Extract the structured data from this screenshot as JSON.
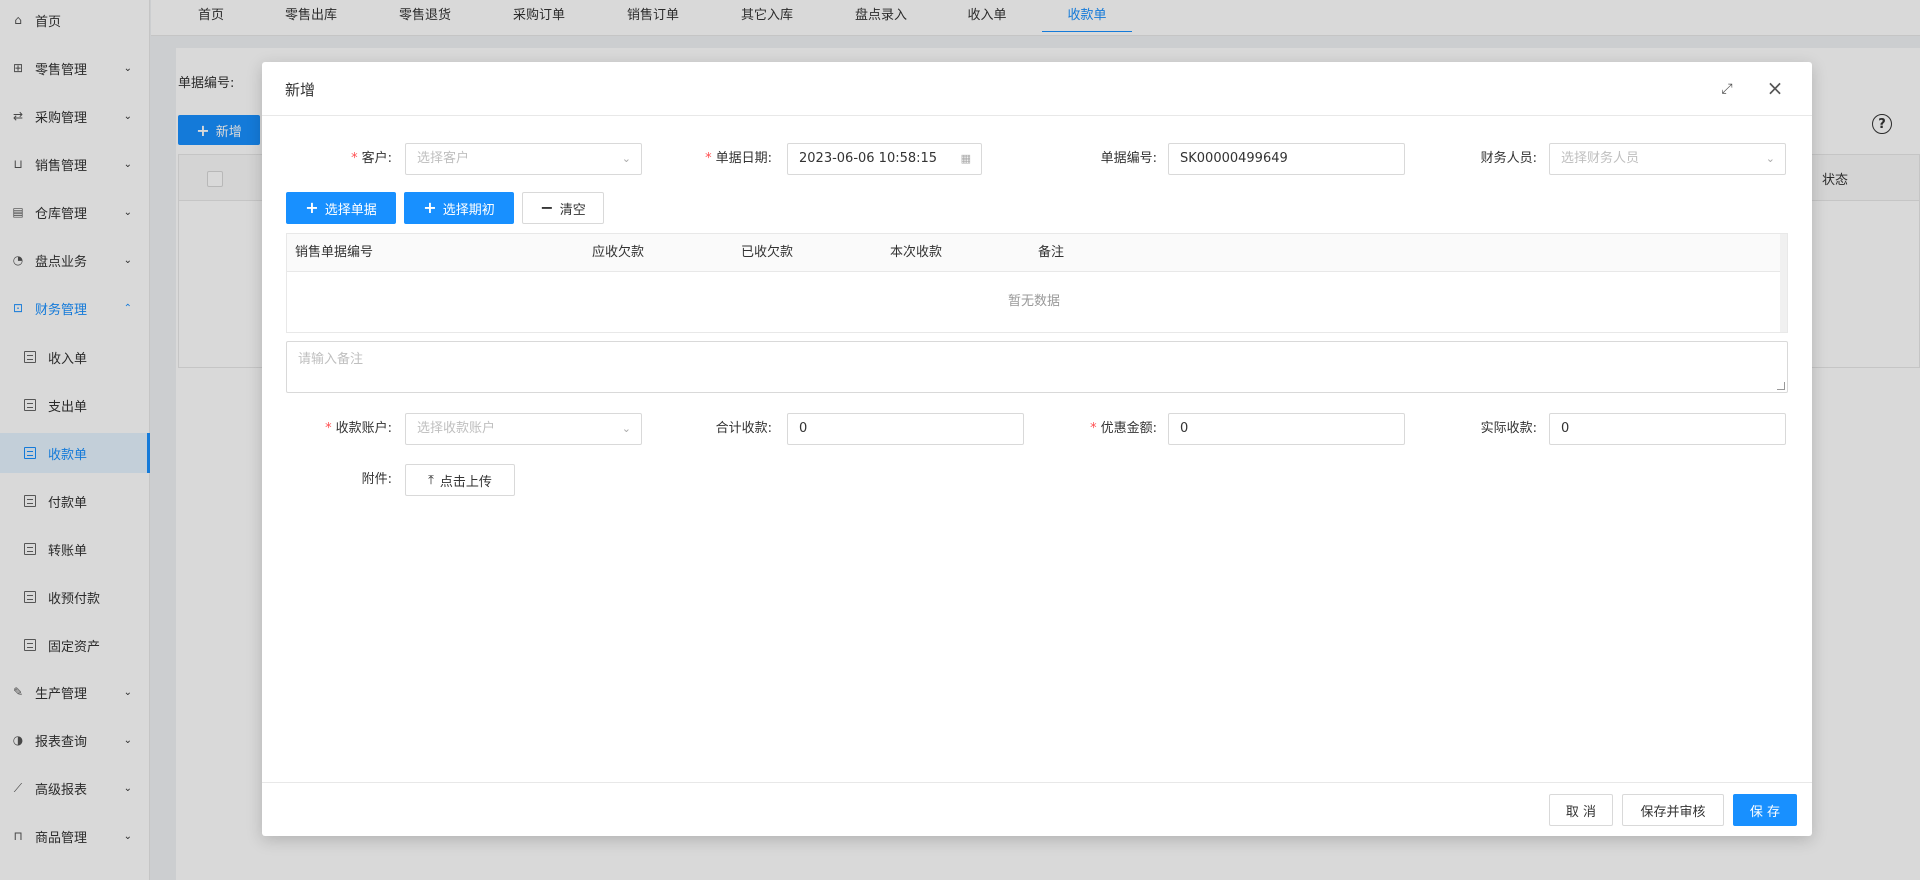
{
  "sidebar": {
    "menu": [
      {
        "label": "首页",
        "icon": "home-icon",
        "arrow": ""
      },
      {
        "label": "零售管理",
        "icon": "gift-icon",
        "arrow": "⌄"
      },
      {
        "label": "采购管理",
        "icon": "swap-icon",
        "arrow": "⌄"
      },
      {
        "label": "销售管理",
        "icon": "cart-icon",
        "arrow": "⌄"
      },
      {
        "label": "仓库管理",
        "icon": "warehouse-icon",
        "arrow": "⌄"
      },
      {
        "label": "盘点业务",
        "icon": "dashboard-icon",
        "arrow": "⌄"
      },
      {
        "label": "财务管理",
        "icon": "finance-icon",
        "arrow": "⌃"
      },
      {
        "label": "生产管理",
        "icon": "wrench-icon",
        "arrow": "⌄"
      },
      {
        "label": "报表查询",
        "icon": "pie-icon",
        "arrow": "⌄"
      },
      {
        "label": "高级报表",
        "icon": "line-chart-icon",
        "arrow": "⌄"
      },
      {
        "label": "商品管理",
        "icon": "bag-icon",
        "arrow": "⌄"
      }
    ],
    "finance_sub": [
      "收入单",
      "支出单",
      "收款单",
      "付款单",
      "转账单",
      "收预付款",
      "固定资产"
    ]
  },
  "tabs": [
    "首页",
    "零售出库",
    "零售退货",
    "采购订单",
    "销售订单",
    "其它入库",
    "盘点录入",
    "收入单",
    "收款单"
  ],
  "background": {
    "doc_no_label": "单据编号:",
    "add_button": "新增",
    "status_header": "状态"
  },
  "modal": {
    "title": "新增",
    "customer_label": "客户:",
    "customer_placeholder": "选择客户",
    "date_label": "单据日期:",
    "date_value": "2023-06-06 10:58:15",
    "doc_no_label": "单据编号:",
    "doc_no_value": "SK00000499649",
    "finance_staff_label": "财务人员:",
    "finance_staff_placeholder": "选择财务人员",
    "select_doc_button": "选择单据",
    "select_initial_button": "选择期初",
    "clear_button": "清空",
    "table_headers": [
      "销售单据编号",
      "应收欠款",
      "已收欠款",
      "本次收款",
      "备注"
    ],
    "table_empty": "暂无数据",
    "remark_placeholder": "请输入备注",
    "account_label": "收款账户:",
    "account_placeholder": "选择收款账户",
    "total_label": "合计收款:",
    "total_value": "0",
    "discount_label": "优惠金额:",
    "discount_value": "0",
    "actual_label": "实际收款:",
    "actual_value": "0",
    "attachment_label": "附件:",
    "upload_button": "点击上传",
    "cancel_button": "取 消",
    "save_audit_button": "保存并审核",
    "save_button": "保 存"
  },
  "colors": {
    "primary": "#1890ff",
    "required": "#ff4d4f"
  }
}
